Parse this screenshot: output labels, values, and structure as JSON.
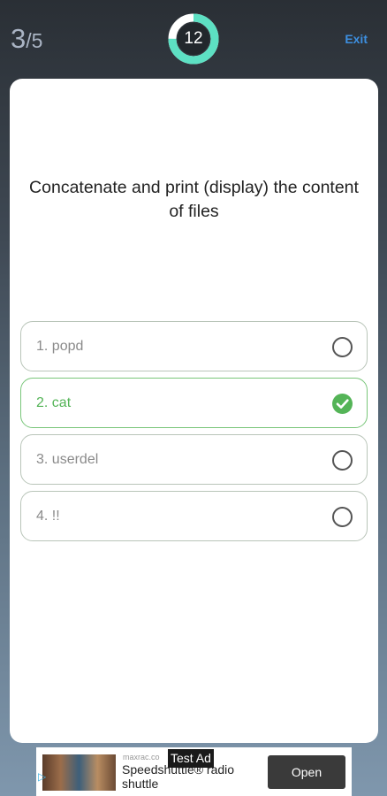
{
  "header": {
    "progress_current": "3",
    "progress_total": "/5",
    "timer_value": "12",
    "timer_fraction_remaining": 0.75,
    "exit_label": "Exit"
  },
  "quiz": {
    "question": "Concatenate and print (display) the content of files",
    "options": [
      {
        "label": "1. popd",
        "selected": false
      },
      {
        "label": "2. cat",
        "selected": true
      },
      {
        "label": "3. userdel",
        "selected": false
      },
      {
        "label": "4. !!",
        "selected": false
      }
    ]
  },
  "ad": {
    "tag": "Test Ad",
    "domain": "maxrac.co",
    "title": "Speedshuttle® radio shuttle",
    "button_label": "Open"
  },
  "colors": {
    "accent_timer": "#5de0c3",
    "correct": "#54b457",
    "exit_link": "#3d8fe0"
  }
}
